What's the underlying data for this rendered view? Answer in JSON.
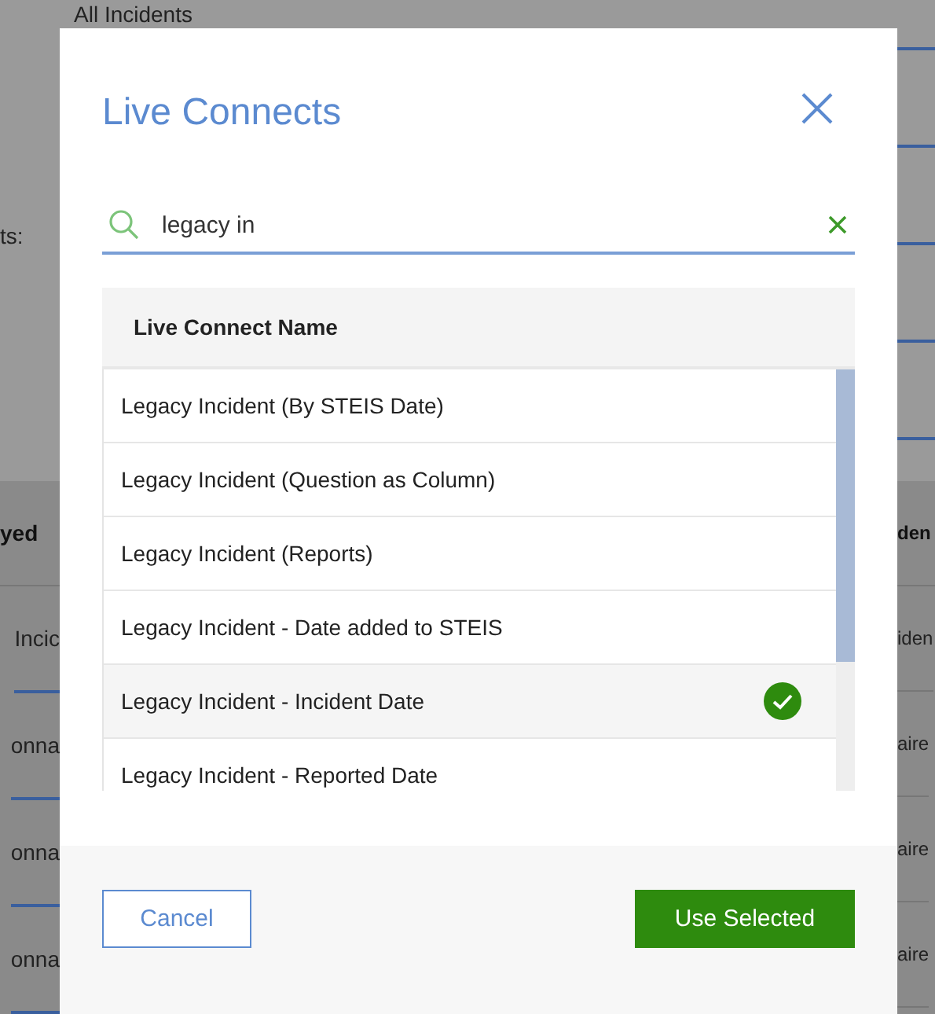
{
  "background": {
    "top_link": "All Incidents",
    "left_label": "ts:",
    "left_header": "yed",
    "left_cells": [
      "Incic",
      "onna",
      "onna",
      "onna"
    ],
    "right_header": "den",
    "right_cells": [
      "iden",
      "aire",
      "aire",
      "aire"
    ]
  },
  "dialog": {
    "title": "Live Connects",
    "search": {
      "value": "legacy in"
    },
    "column": "Live Connect Name",
    "rows": [
      {
        "name": "Legacy Incident (By STEIS Date)",
        "selected": false
      },
      {
        "name": "Legacy Incident (Question as Column)",
        "selected": false
      },
      {
        "name": "Legacy Incident (Reports)",
        "selected": false
      },
      {
        "name": "Legacy Incident - Date added to STEIS",
        "selected": false
      },
      {
        "name": "Legacy Incident - Incident Date",
        "selected": true
      },
      {
        "name": "Legacy Incident - Reported Date",
        "selected": false
      }
    ],
    "buttons": {
      "cancel": "Cancel",
      "confirm": "Use Selected"
    }
  }
}
